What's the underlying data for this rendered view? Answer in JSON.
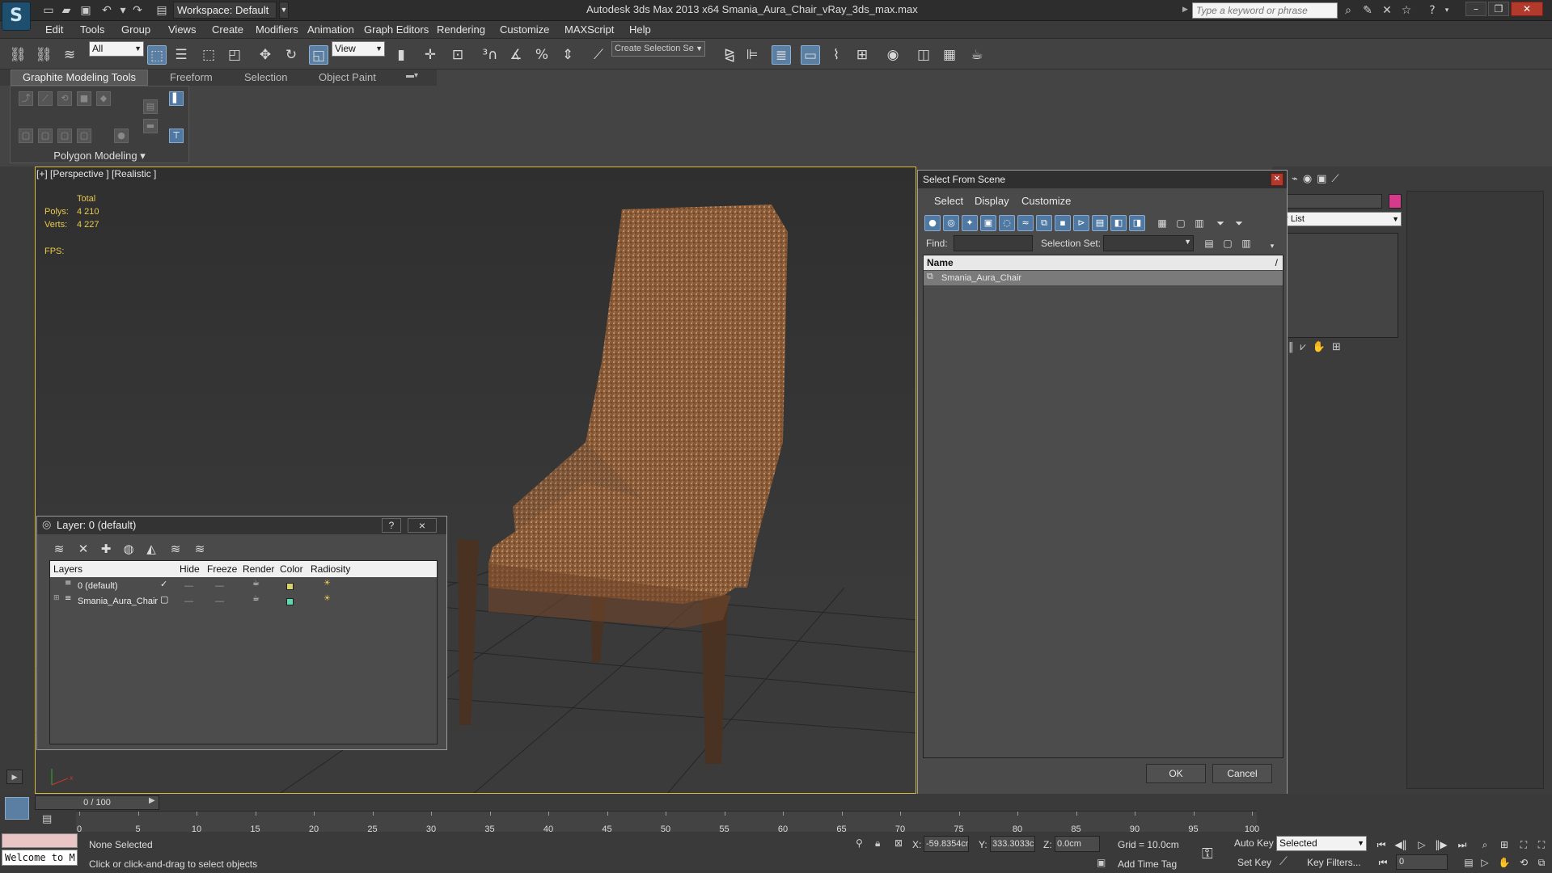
{
  "titlebar": {
    "workspace": "Workspace: Default",
    "title": "Autodesk 3ds Max  2013 x64     Smania_Aura_Chair_vRay_3ds_max.max",
    "search_placeholder": "Type a keyword or phrase"
  },
  "menubar": {
    "items": [
      "Edit",
      "Tools",
      "Group",
      "Views",
      "Create",
      "Modifiers",
      "Animation",
      "Graph Editors",
      "Rendering",
      "Customize",
      "MAXScript",
      "Help"
    ]
  },
  "toolbar": {
    "selection_filter": "All",
    "reference_coord": "View",
    "named_selection_placeholder": "Create Selection Se"
  },
  "ribbon": {
    "tabs": [
      "Graphite Modeling Tools",
      "Freeform",
      "Selection",
      "Object Paint"
    ],
    "panel_label": "Polygon Modeling"
  },
  "viewport": {
    "label": "[+] [Perspective ] [Realistic ]",
    "stats": {
      "total": "Total",
      "polys_label": "Polys:",
      "polys": "4 210",
      "verts_label": "Verts:",
      "verts": "4 227",
      "fps_label": "FPS:"
    }
  },
  "select_from_scene": {
    "title": "Select From Scene",
    "menus": [
      "Select",
      "Display",
      "Customize"
    ],
    "find_label": "Find:",
    "selection_set_label": "Selection Set:",
    "column_name": "Name",
    "items": [
      "Smania_Aura_Chair"
    ],
    "ok": "OK",
    "cancel": "Cancel"
  },
  "right_panel": {
    "modifier_list": "er List"
  },
  "layer_dialog": {
    "title": "Layer: 0 (default)",
    "help": "?",
    "close": "×",
    "columns": [
      "Layers",
      "Hide",
      "Freeze",
      "Render",
      "Color",
      "Radiosity"
    ],
    "rows": [
      {
        "name": "0 (default)",
        "color": "#d6d36a"
      },
      {
        "name": "Smania_Aura_Chair",
        "color": "#5fd7b0"
      }
    ]
  },
  "timeline": {
    "slider": "0 / 100",
    "ticks": [
      "0",
      "5",
      "10",
      "15",
      "20",
      "25",
      "30",
      "35",
      "40",
      "45",
      "50",
      "55",
      "60",
      "65",
      "70",
      "75",
      "80",
      "85",
      "90",
      "95",
      "100"
    ]
  },
  "status": {
    "welcome": "Welcome to M",
    "selection": "None Selected",
    "prompt": "Click or click-and-drag to select objects",
    "x_label": "X:",
    "x": "-59.8354cr",
    "y_label": "Y:",
    "y": "333.3033cr",
    "z_label": "Z:",
    "z": "0.0cm",
    "grid": "Grid = 10.0cm",
    "add_time_tag": "Add Time Tag",
    "auto_key": "Auto Key",
    "set_key": "Set Key",
    "key_mode": "Selected",
    "key_filters": "Key Filters...",
    "frame": "0"
  }
}
